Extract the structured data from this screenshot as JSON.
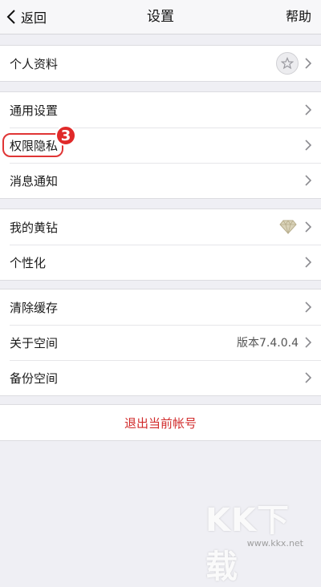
{
  "nav": {
    "back": "返回",
    "title": "设置",
    "help": "帮助"
  },
  "groups": [
    {
      "items": [
        {
          "label": "个人资料",
          "icon": "star-icon"
        }
      ]
    },
    {
      "items": [
        {
          "label": "通用设置"
        },
        {
          "label": "权限隐私",
          "step": "3"
        },
        {
          "label": "消息通知"
        }
      ]
    },
    {
      "items": [
        {
          "label": "我的黄钻",
          "icon": "diamond-icon"
        },
        {
          "label": "个性化"
        }
      ]
    },
    {
      "items": [
        {
          "label": "清除缓存"
        },
        {
          "label": "关于空间",
          "value": "版本7.4.0.4"
        },
        {
          "label": "备份空间"
        }
      ]
    }
  ],
  "logout": "退出当前帐号",
  "watermark": {
    "big": "KK下载",
    "small": "www.kkx.net"
  },
  "colors": {
    "accent_red": "#d12b2b",
    "highlight": "#e03535",
    "background": "#efeff4"
  }
}
